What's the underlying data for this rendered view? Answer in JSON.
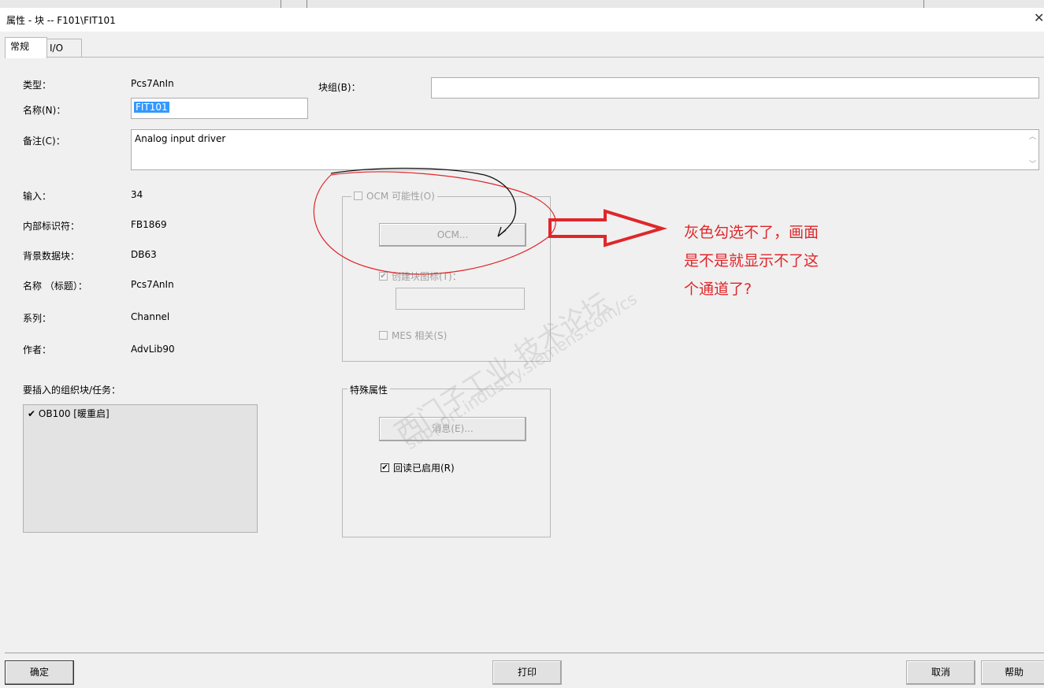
{
  "window": {
    "title": "属性 - 块 -- F101\\FIT101",
    "close_glyph": "✕"
  },
  "tabs": [
    {
      "label": "常规",
      "active": true
    },
    {
      "label": "I/O",
      "active": false
    }
  ],
  "general": {
    "type_label": "类型：",
    "type_value": "Pcs7AnIn",
    "name_label": "名称(N)：",
    "name_value": "FIT101",
    "block_group_label": "块组(B)：",
    "block_group_value": "",
    "comment_label": "备注(C)：",
    "comment_value": "Analog input driver",
    "input_label": "输入：",
    "input_value": "34",
    "internal_id_label": "内部标识符：",
    "internal_id_value": "FB1869",
    "instance_db_label": "背景数据块：",
    "instance_db_value": "DB63",
    "name_title_label": "名称 （标题）：",
    "name_title_value": "Pcs7AnIn",
    "family_label": "系列：",
    "family_value": "Channel",
    "author_label": "作者：",
    "author_value": "AdvLib90",
    "ob_label": "要插入的组织块/任务：",
    "ob_items": [
      {
        "label": "OB100 [暖重启]",
        "checked": true
      }
    ]
  },
  "ocm": {
    "checkbox_label": "OCM 可能性(O)",
    "checked": false,
    "enabled": false,
    "button_label": "OCM...",
    "create_icon_label": "创建块图标(T)：",
    "create_icon_checked": true,
    "create_icon_value": "",
    "mes_label": "MES 相关(S)",
    "mes_checked": false
  },
  "special": {
    "group_label": "特殊属性",
    "messages_button": "消息(E)...",
    "readback_label": "回读已启用(R)",
    "readback_checked": true
  },
  "footer": {
    "ok": "确定",
    "print": "打印",
    "cancel": "取消",
    "help": "帮助"
  },
  "annotation": {
    "lines": [
      "灰色勾选不了，画面",
      "是不是就显示不了这",
      "个通道了?"
    ],
    "color": "#e0262a"
  },
  "watermark": {
    "cn": "西门子工业 技术论坛",
    "url": "support.industry.siemens.com/cs"
  }
}
